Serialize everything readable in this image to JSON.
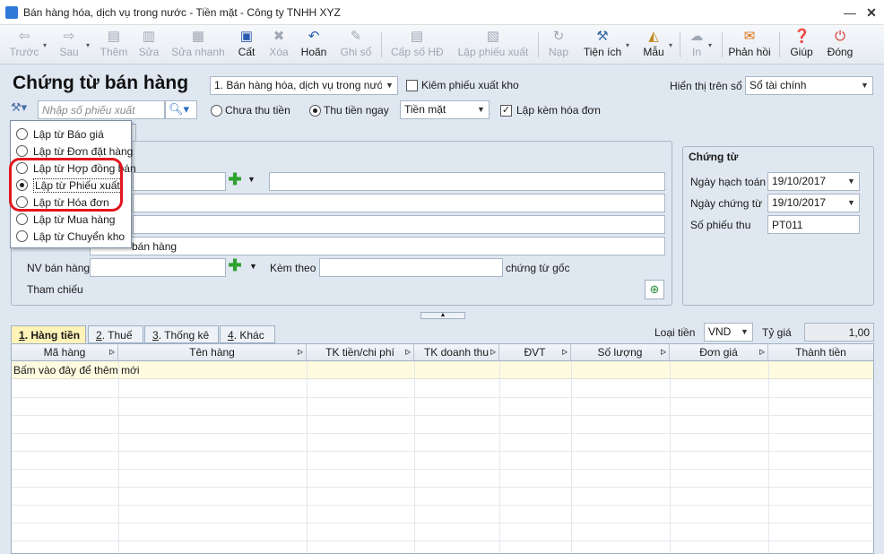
{
  "window": {
    "title": "Bán hàng hóa, dịch vụ trong nước - Tiền mặt - Công ty TNHH XYZ"
  },
  "toolbar": [
    {
      "id": "truoc",
      "label": "Trước",
      "icon": "arrow-left-icon",
      "enabled": false,
      "caret": true
    },
    {
      "id": "sau",
      "label": "Sau",
      "icon": "arrow-right-icon",
      "enabled": false,
      "caret": true
    },
    {
      "id": "them",
      "label": "Thêm",
      "icon": "add-doc-icon",
      "enabled": false
    },
    {
      "id": "sua",
      "label": "Sửa",
      "icon": "edit-doc-icon",
      "enabled": false
    },
    {
      "id": "suanhanh",
      "label": "Sửa nhanh",
      "icon": "quick-edit-icon",
      "enabled": false
    },
    {
      "id": "cat",
      "label": "Cất",
      "icon": "save-icon",
      "enabled": true
    },
    {
      "id": "xoa",
      "label": "Xóa",
      "icon": "delete-icon",
      "enabled": false
    },
    {
      "id": "hoan",
      "label": "Hoãn",
      "icon": "undo-icon",
      "enabled": true
    },
    {
      "id": "ghiso",
      "label": "Ghi sổ",
      "icon": "pencil-icon",
      "enabled": false
    },
    {
      "id": "capsohd",
      "label": "Cấp số HĐ",
      "icon": "invoice-number-icon",
      "enabled": false
    },
    {
      "id": "lapphieuxuat",
      "label": "Lập phiếu xuất",
      "icon": "export-slip-icon",
      "enabled": false
    },
    {
      "id": "nap",
      "label": "Nạp",
      "icon": "reload-icon",
      "enabled": false
    },
    {
      "id": "tienich",
      "label": "Tiện ích",
      "icon": "tools-icon",
      "enabled": true,
      "caret": true
    },
    {
      "id": "mau",
      "label": "Mẫu",
      "icon": "template-icon",
      "enabled": true,
      "caret": true
    },
    {
      "id": "in",
      "label": "In",
      "icon": "print-icon",
      "enabled": false,
      "caret": true
    },
    {
      "id": "phanhoi",
      "label": "Phản hồi",
      "icon": "feedback-icon",
      "enabled": true
    },
    {
      "id": "giup",
      "label": "Giúp",
      "icon": "help-icon",
      "enabled": true
    },
    {
      "id": "dong",
      "label": "Đóng",
      "icon": "close-window-icon",
      "enabled": true
    }
  ],
  "header": {
    "page_title": "Chứng từ bán hàng",
    "sale_type": "1. Bán hàng hóa, dịch vụ trong nước",
    "kiem_phieu_xuat_kho": "Kiêm phiếu xuất kho",
    "hien_thi_tren_so_label": "Hiển thị trên sổ",
    "hien_thi_tren_so_value": "Sổ tài chính",
    "search_placeholder": "Nhập số phiếu xuất",
    "chua_thu_tien": "Chưa thu tiền",
    "thu_tien_ngay": "Thu tiền ngay",
    "payment_method": "Tiền mặt",
    "lap_kem_hoa_don": "Lập kèm hóa đơn"
  },
  "popup": {
    "items": [
      {
        "label": "Lập từ Báo giá",
        "selected": false
      },
      {
        "label": "Lập từ Đơn đặt hàng",
        "selected": false
      },
      {
        "label": "Lập từ Hợp đồng bán",
        "selected": false
      },
      {
        "label": "Lập từ Phiếu xuất",
        "selected": true
      },
      {
        "label": "Lập từ Hóa đơn",
        "selected": false
      },
      {
        "label": "Lập từ Mua hàng",
        "selected": false
      },
      {
        "label": "Lập từ Chuyển kho",
        "selected": false
      }
    ]
  },
  "form": {
    "ly_do_value": "bán hàng",
    "nv_ban_hang_label": "NV bán hàng",
    "kem_theo_label": "Kèm theo",
    "chung_tu_goc_label": "chứng từ gốc",
    "tham_chieu_label": "Tham chiếu"
  },
  "chung_tu": {
    "title": "Chứng từ",
    "ngay_hach_toan_label": "Ngày hạch toán",
    "ngay_hach_toan": "19/10/2017",
    "ngay_chung_tu_label": "Ngày chứng từ",
    "ngay_chung_tu": "19/10/2017",
    "so_phieu_thu_label": "Số phiếu thu",
    "so_phieu_thu": "PT011"
  },
  "tabs": [
    {
      "num": "1",
      "label": ". Hàng tiền",
      "active": true
    },
    {
      "num": "2",
      "label": ". Thuế",
      "active": false
    },
    {
      "num": "3",
      "label": ". Thống kê",
      "active": false
    },
    {
      "num": "4",
      "label": ". Khác",
      "active": false
    }
  ],
  "currency": {
    "loai_tien_label": "Loại tiền",
    "loai_tien": "VND",
    "ty_gia_label": "Tỷ giá",
    "ty_gia": "1,00"
  },
  "grid": {
    "columns": [
      "Mã hàng",
      "Tên hàng",
      "TK tiền/chi phí",
      "TK doanh thu",
      "ĐVT",
      "Số lượng",
      "Đơn giá",
      "Thành tiền"
    ],
    "hint": "Bấm vào đây để thêm mới"
  }
}
